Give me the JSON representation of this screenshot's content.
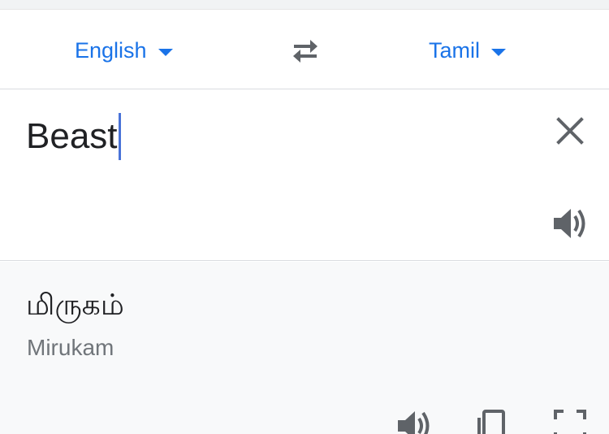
{
  "languages": {
    "source": "English",
    "target": "Tamil"
  },
  "input": {
    "text": "Beast"
  },
  "output": {
    "translation": "மிருகம்",
    "transliteration": "Mirukam"
  },
  "icons": {
    "source_dropdown": "chevron-down-icon",
    "swap": "swap-arrows-icon",
    "target_dropdown": "chevron-down-icon",
    "clear": "close-icon",
    "listen_source": "speaker-icon",
    "listen_output": "speaker-icon",
    "copy": "copy-icon",
    "fullscreen": "fullscreen-icon"
  },
  "colors": {
    "accent": "#1a73e8",
    "cursor": "#4a73d8",
    "icon_gray": "#5f6368",
    "output_bg": "#f8f9fa"
  }
}
